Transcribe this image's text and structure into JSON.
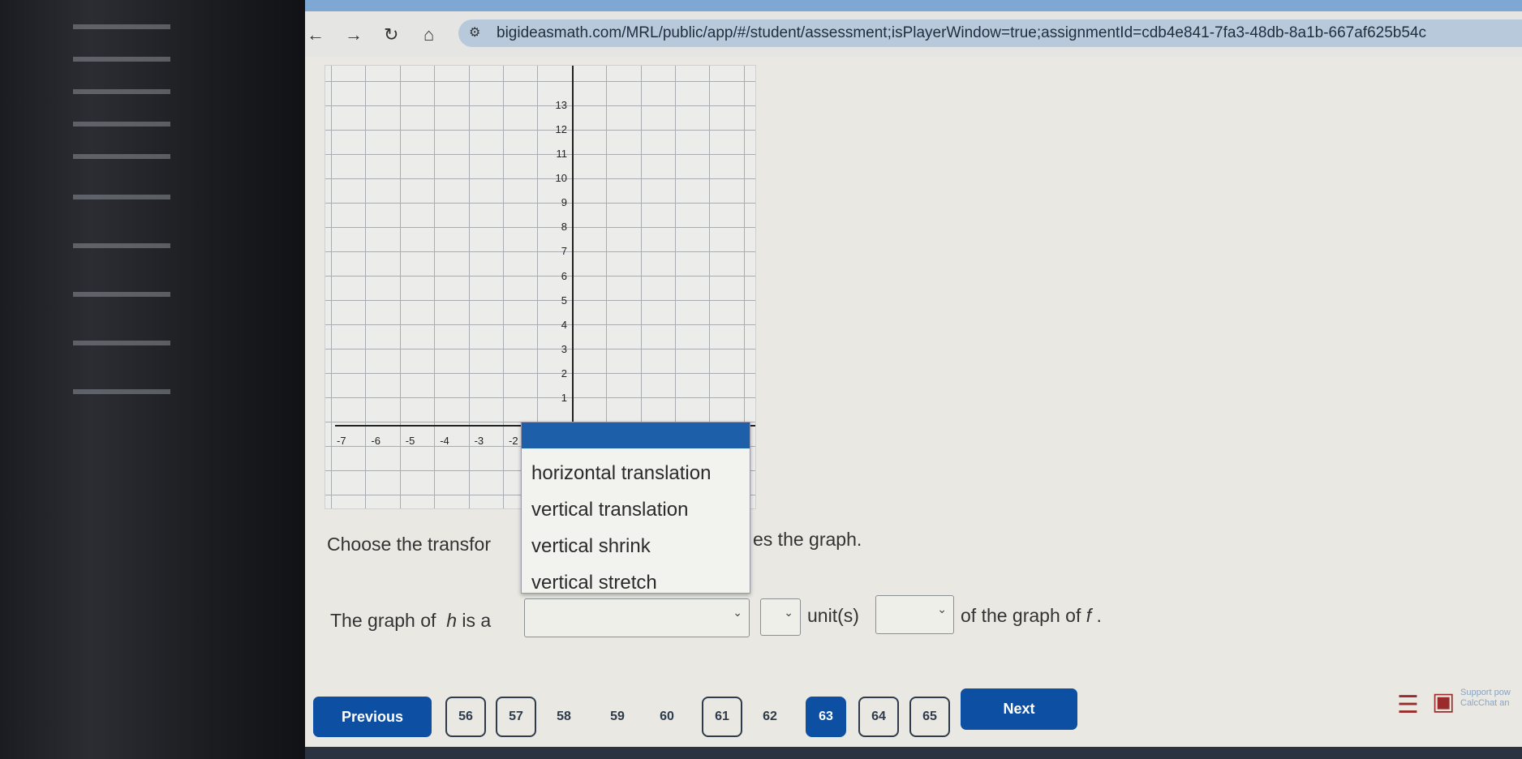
{
  "browser": {
    "url": "bigideasmath.com/MRL/public/app/#/student/assessment;isPlayerWindow=true;assignmentId=cdb4e841-7fa3-48db-8a1b-667af625b54c",
    "nav_icons": [
      "back-arrow-icon",
      "forward-arrow-icon",
      "reload-icon",
      "home-icon",
      "site-settings-icon"
    ]
  },
  "graph": {
    "y_ticks": [
      "1",
      "2",
      "3",
      "4",
      "5",
      "6",
      "7",
      "8",
      "9",
      "10",
      "11",
      "12",
      "13"
    ],
    "x_ticks": [
      "-7",
      "-6",
      "-5",
      "-4",
      "-3",
      "-2"
    ]
  },
  "dropdown": {
    "options": [
      "horizontal translation",
      "vertical translation",
      "vertical shrink",
      "vertical stretch"
    ]
  },
  "question": {
    "prompt_start": "Choose the transfor",
    "prompt_end": "es the graph.",
    "sentence_start": "The graph of",
    "h": "h",
    "is_a": "is a",
    "units": "unit(s)",
    "sentence_end": "of the graph of",
    "f": "f",
    "period": "."
  },
  "pagination": {
    "previous": "Previous",
    "next": "Next",
    "pages": [
      "56",
      "57",
      "58",
      "59",
      "60",
      "61",
      "62",
      "63",
      "64",
      "65"
    ],
    "current": "63",
    "boxed": [
      "56",
      "57",
      "61",
      "64",
      "65"
    ]
  },
  "support": {
    "line1": "Support pow",
    "line2": "CalcChat an"
  },
  "colors": {
    "primary": "#0d4fa3",
    "support_icon": "#9b2a2a"
  }
}
